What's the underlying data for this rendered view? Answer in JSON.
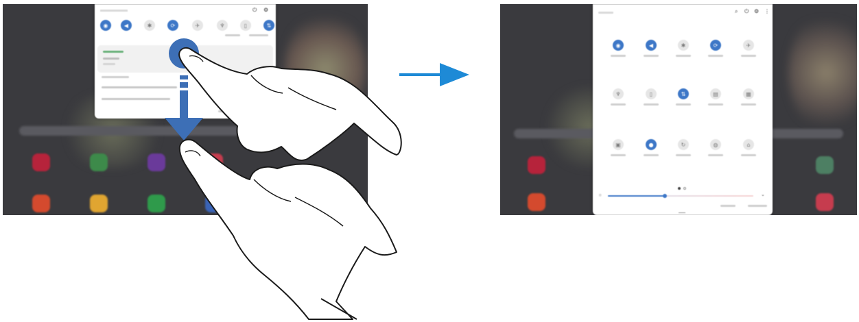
{
  "left_panel": {
    "toggles": [
      {
        "icon": "wifi-icon",
        "glyph": "◉",
        "state": "on"
      },
      {
        "icon": "sound-icon",
        "glyph": "◀",
        "state": "on"
      },
      {
        "icon": "bluetooth-icon",
        "glyph": "✱",
        "state": "off"
      },
      {
        "icon": "auto-rotate-icon",
        "glyph": "⟳",
        "state": "on"
      },
      {
        "icon": "airplane-mode-icon",
        "glyph": "✈",
        "state": "off"
      },
      {
        "icon": "flashlight-icon",
        "glyph": "♆",
        "state": "off"
      },
      {
        "icon": "power-saving-icon",
        "glyph": "▯",
        "state": "off"
      },
      {
        "icon": "mobile-data-icon",
        "glyph": "⇅",
        "state": "on"
      }
    ]
  },
  "right_panel": {
    "toggles": [
      {
        "icon": "wifi-icon",
        "glyph": "◉",
        "state": "on"
      },
      {
        "icon": "sound-icon",
        "glyph": "◀",
        "state": "on"
      },
      {
        "icon": "bluetooth-icon",
        "glyph": "✱",
        "state": "off"
      },
      {
        "icon": "auto-rotate-icon",
        "glyph": "⟳",
        "state": "on"
      },
      {
        "icon": "airplane-mode-icon",
        "glyph": "✈",
        "state": "off"
      },
      {
        "icon": "flashlight-icon",
        "glyph": "♆",
        "state": "off"
      },
      {
        "icon": "power-saving-icon",
        "glyph": "▯",
        "state": "off"
      },
      {
        "icon": "mobile-data-icon",
        "glyph": "⇅",
        "state": "on"
      },
      {
        "icon": "nfc-icon",
        "glyph": "▤",
        "state": "off"
      },
      {
        "icon": "qr-scanner-icon",
        "glyph": "▦",
        "state": "off"
      },
      {
        "icon": "secure-folder-icon",
        "glyph": "▣",
        "state": "off"
      },
      {
        "icon": "location-icon",
        "glyph": "●",
        "state": "on"
      },
      {
        "icon": "sync-icon",
        "glyph": "↻",
        "state": "off"
      },
      {
        "icon": "dolby-atmos-icon",
        "glyph": "◍",
        "state": "off"
      },
      {
        "icon": "dex-icon",
        "glyph": "⌂",
        "state": "off"
      }
    ],
    "brightness_level": 0.39
  },
  "colors": {
    "arrow": "#1e8ad6",
    "toggle_on": "#3d77c7",
    "screen_background": "#3a3a3e"
  }
}
